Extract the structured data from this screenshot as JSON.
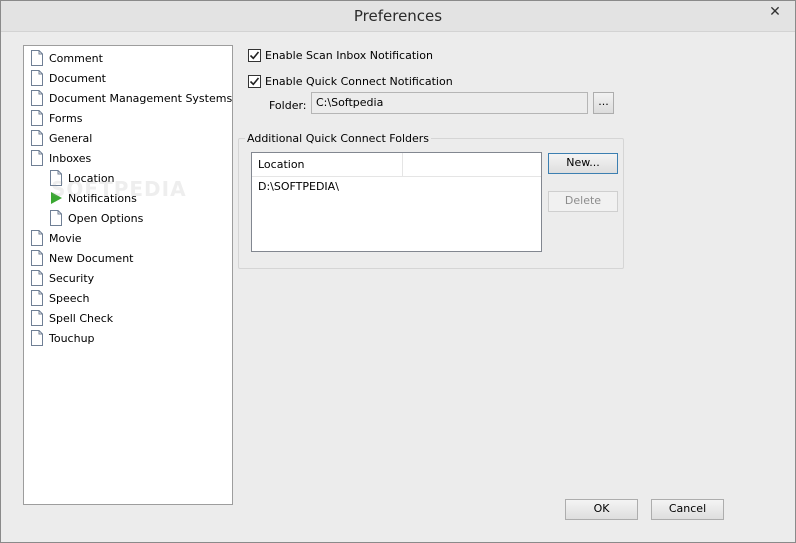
{
  "window": {
    "title": "Preferences",
    "close_glyph": "✕"
  },
  "tree": {
    "items": [
      {
        "label": "Comment",
        "icon": "document-icon",
        "level": 0
      },
      {
        "label": "Document",
        "icon": "document-icon",
        "level": 0
      },
      {
        "label": "Document Management Systems",
        "icon": "document-icon",
        "level": 0
      },
      {
        "label": "Forms",
        "icon": "document-icon",
        "level": 0
      },
      {
        "label": "General",
        "icon": "document-icon",
        "level": 0
      },
      {
        "label": "Inboxes",
        "icon": "document-icon",
        "level": 0
      },
      {
        "label": "Location",
        "icon": "document-icon",
        "level": 1
      },
      {
        "label": "Notifications",
        "icon": "selected-arrow-icon",
        "level": 1,
        "selected": true
      },
      {
        "label": "Open Options",
        "icon": "document-icon",
        "level": 1
      },
      {
        "label": "Movie",
        "icon": "document-icon",
        "level": 0
      },
      {
        "label": "New Document",
        "icon": "document-icon",
        "level": 0
      },
      {
        "label": "Security",
        "icon": "document-icon",
        "level": 0
      },
      {
        "label": "Speech",
        "icon": "document-icon",
        "level": 0
      },
      {
        "label": "Spell Check",
        "icon": "document-icon",
        "level": 0
      },
      {
        "label": "Touchup",
        "icon": "document-icon",
        "level": 0
      }
    ]
  },
  "notifications": {
    "scan_inbox": {
      "label": "Enable Scan Inbox Notification",
      "checked": true
    },
    "quick_connect": {
      "label": "Enable Quick Connect Notification",
      "checked": true
    },
    "folder_label": "Folder:",
    "folder_value": "C:\\Softpedia",
    "browse_label": "..."
  },
  "additional_folders": {
    "group_label": "Additional Quick Connect Folders",
    "columns": [
      "Location",
      ""
    ],
    "rows": [
      "D:\\SOFTPEDIA\\"
    ],
    "new_button": "New...",
    "delete_button": "Delete"
  },
  "footer": {
    "ok": "OK",
    "cancel": "Cancel"
  },
  "watermark": "SOFTPEDIA",
  "colors": {
    "selected_arrow": "#3aa832",
    "accent_border": "#3c7fb1"
  }
}
